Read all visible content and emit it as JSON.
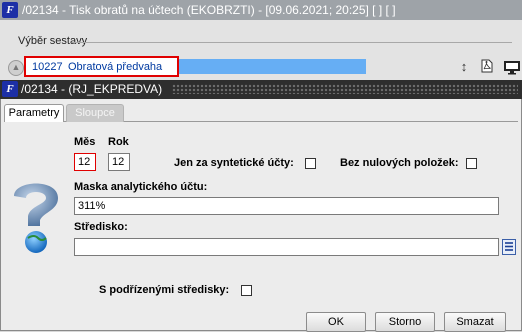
{
  "background_window": {
    "title": "/02134 - Tisk obratů na účtech (EKOBRZTI) - [09.06.2021; 20:25]  [ ]  [ ]",
    "section_legend": "Výběr sestavy",
    "selected_report": {
      "code": "10227",
      "name": "Obratová předvaha"
    },
    "toolbar_icons": [
      "sort-icon",
      "pdf-icon",
      "monitor-icon"
    ]
  },
  "dialog": {
    "title": "/02134 - (RJ_EKPREDVA)",
    "tabs": [
      {
        "label": "Parametry",
        "active": true
      },
      {
        "label": "Sloupce",
        "active": false
      }
    ],
    "month": {
      "label": "Měs",
      "value": "12"
    },
    "year": {
      "label": "Rok",
      "value": "12"
    },
    "synthetic_only": {
      "label": "Jen za syntetické účty:",
      "checked": false
    },
    "no_zero_items": {
      "label": "Bez nulových položek:",
      "checked": false
    },
    "analytic_mask": {
      "label": "Maska analytického účtu:",
      "value": "311%"
    },
    "center": {
      "label": "Středisko:",
      "value": ""
    },
    "sub_centers": {
      "label": "S podřízenými středisky:",
      "checked": false
    },
    "buttons": {
      "ok": "OK",
      "cancel": "Storno",
      "delete": "Smazat"
    }
  },
  "colors": {
    "highlight_border": "#e00000",
    "selection_fill": "#66aef4",
    "dialog_titlebar": "#2e2e2e",
    "logo_blue": "#1c2fa6"
  }
}
